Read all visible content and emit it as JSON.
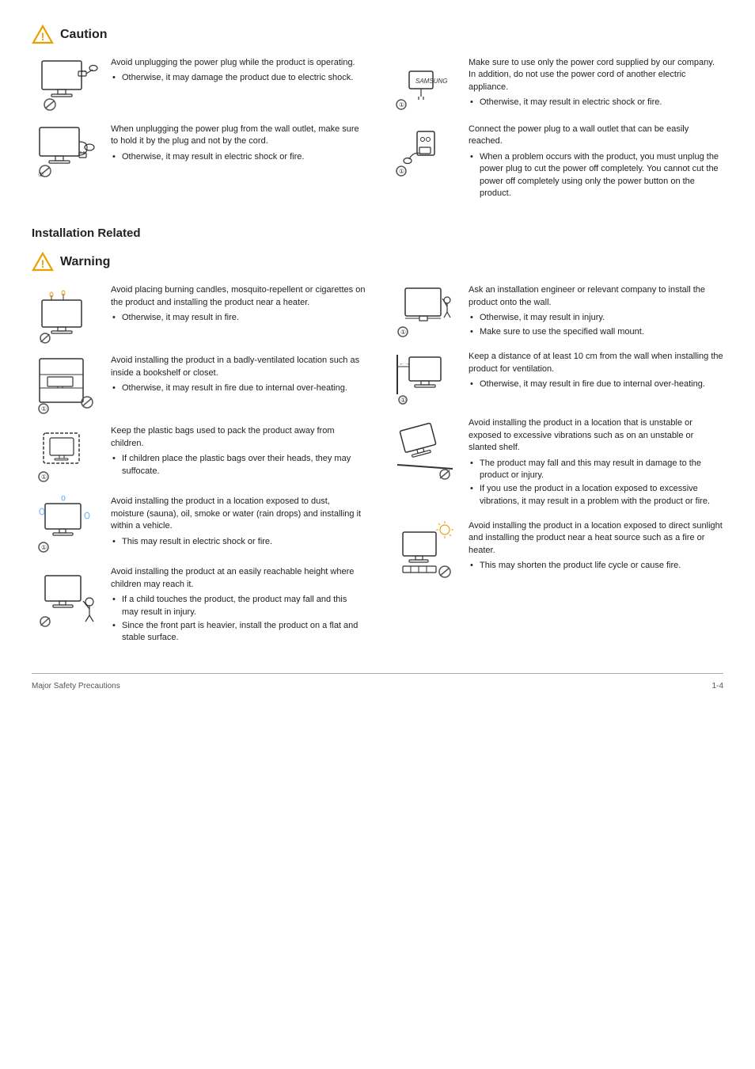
{
  "caution": {
    "title": "Caution",
    "entries": [
      {
        "id": "caution-1",
        "text": "Avoid unplugging the power plug while the product is operating.",
        "bullets": [
          "Otherwise, it may damage the product due to electric shock."
        ]
      },
      {
        "id": "caution-2",
        "text": "Make sure to use only the power cord supplied by our company. In addition, do not use the power cord of another electric appliance.",
        "bullets": [
          "Otherwise, it may result in electric shock or fire."
        ]
      },
      {
        "id": "caution-3",
        "text": "When unplugging the power plug from the wall outlet, make sure to hold it by the plug and not by the cord.",
        "bullets": [
          "Otherwise, it may result in electric shock or fire."
        ]
      },
      {
        "id": "caution-4",
        "text": "Connect the power plug to a wall outlet that can be easily reached.",
        "bullets": [
          "When a problem occurs with the product, you must unplug the power plug to cut the power off completely. You cannot cut the power off completely using only the power button on the product."
        ]
      }
    ]
  },
  "installation": {
    "section_title": "Installation Related",
    "warning": {
      "title": "Warning",
      "entries_left": [
        {
          "id": "warn-1",
          "text": "Avoid placing burning candles,  mosquito-repellent or cigarettes on the product and installing the product near a heater.",
          "bullets": [
            "Otherwise, it may result in fire."
          ]
        },
        {
          "id": "warn-2",
          "text": "Avoid installing the product in a badly-ventilated location such as inside a bookshelf or closet.",
          "bullets": [
            "Otherwise, it may result in fire due to internal over-heating."
          ]
        },
        {
          "id": "warn-3",
          "text": "Keep the plastic bags used to pack the product away from children.",
          "bullets": [
            "If children place the plastic bags over their heads, they may suffocate."
          ]
        },
        {
          "id": "warn-6",
          "text": "Avoid installing the product in a location exposed to dust, moisture (sauna), oil, smoke or water (rain drops) and installing it within a vehicle.",
          "bullets": [
            "This may result in electric shock or fire."
          ]
        },
        {
          "id": "warn-7",
          "text": "Avoid installing the product at an easily reachable height where children may reach it.",
          "bullets": [
            "If a child touches the product, the product may fall and this may result in injury.",
            "Since the front part is heavier, install the product on a flat and stable surface."
          ]
        }
      ],
      "entries_right": [
        {
          "id": "warn-4",
          "text": "Ask an installation engineer or relevant company to install the product onto the wall.",
          "bullets": [
            "Otherwise, it may result in injury.",
            "Make sure to use the specified wall mount."
          ]
        },
        {
          "id": "warn-4b",
          "text": "Keep a distance of at least 10 cm from the wall when installing the product for ventilation.",
          "bullets": [
            "Otherwise, it may result in fire due to internal over-heating."
          ]
        },
        {
          "id": "warn-5",
          "text": "Avoid installing the product in a location that is unstable or exposed to excessive vibrations such as on an unstable or slanted shelf.",
          "bullets": [
            "The product may fall and this may result in damage to the product or injury.",
            "If you use the product in a location exposed to excessive vibrations, it may result in a problem with the product or fire."
          ]
        },
        {
          "id": "warn-8",
          "text": "Avoid installing the product in a location exposed to direct sunlight and installing the product near a heat source such as a fire or heater.",
          "bullets": [
            "This may shorten the product life cycle or cause fire."
          ]
        }
      ]
    }
  },
  "footer": {
    "left": "Major Safety Precautions",
    "right": "1-4"
  }
}
